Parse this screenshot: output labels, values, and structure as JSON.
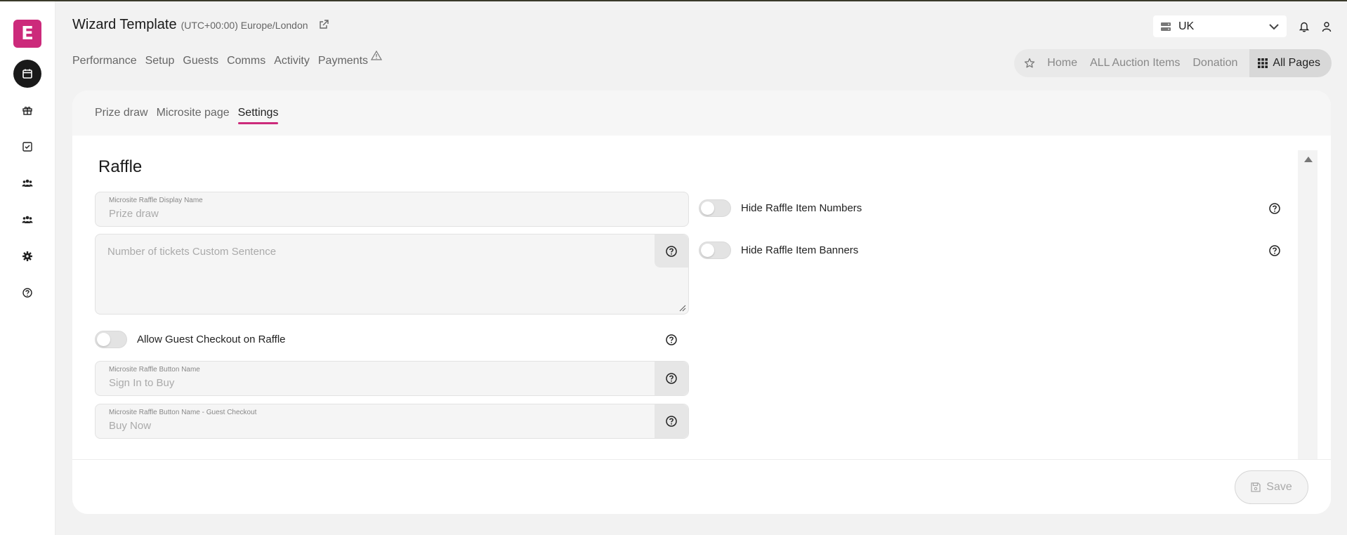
{
  "app": {
    "logo_letter": "E",
    "brand_color": "#cc2a7b"
  },
  "sidebar": {
    "items": [
      {
        "icon": "calendar-icon",
        "active": true
      },
      {
        "icon": "gift-icon"
      },
      {
        "icon": "checkbox-icon"
      },
      {
        "icon": "users-icon"
      },
      {
        "icon": "group-icon"
      },
      {
        "icon": "gear-icon"
      },
      {
        "icon": "help-icon"
      }
    ]
  },
  "header": {
    "title": "Wizard Template",
    "timezone": "(UTC+00:00) Europe/London",
    "region": "UK"
  },
  "main_nav": [
    "Performance",
    "Setup",
    "Guests",
    "Comms",
    "Activity",
    "Payments"
  ],
  "quick_nav": {
    "items": [
      "Home",
      "ALL Auction Items",
      "Donation"
    ],
    "all_pages": "All Pages"
  },
  "card": {
    "tabs": [
      "Prize draw",
      "Microsite page",
      "Settings"
    ],
    "active_tab": "Settings",
    "section_title": "Raffle",
    "fields": {
      "display_name": {
        "label": "Microsite Raffle Display Name",
        "value": "Prize draw"
      },
      "tickets_sentence": {
        "placeholder": "Number of tickets Custom Sentence"
      },
      "button_name": {
        "label": "Microsite Raffle Button Name",
        "value": "Sign In to Buy"
      },
      "button_name_guest": {
        "label": "Microsite Raffle Button Name - Guest Checkout",
        "value": "Buy Now"
      }
    },
    "toggles": {
      "guest_checkout": "Allow Guest Checkout on Raffle",
      "hide_numbers": "Hide Raffle Item Numbers",
      "hide_banners": "Hide Raffle Item Banners"
    },
    "save_label": "Save"
  }
}
